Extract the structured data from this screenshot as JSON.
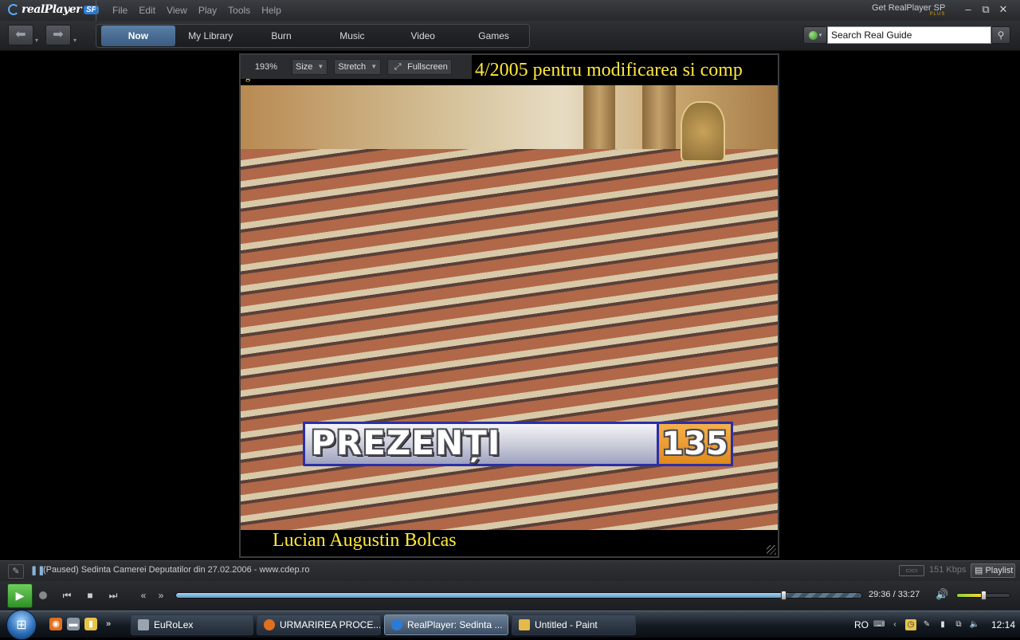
{
  "app": {
    "logo_text": "realPlayer",
    "logo_badge": "SP",
    "menu": [
      "File",
      "Edit",
      "View",
      "Play",
      "Tools",
      "Help"
    ],
    "get_sp": "Get RealPlayer SP",
    "get_sp_plus": "PLUS"
  },
  "toolbar": {
    "tabs": [
      "Now Playing",
      "My Library",
      "Burn",
      "Music",
      "Video",
      "Games"
    ],
    "active_tab": "Now Playing",
    "search_placeholder": "Search Real Guide"
  },
  "video_toolbar": {
    "zoom": "193%",
    "size_label": "Size",
    "stretch_label": "Stretch",
    "fullscreen_label": "Fullscreen"
  },
  "video": {
    "top_caption": "4/2005 pentru modificarea si comp",
    "top_caption_fragment": "g",
    "overlay_label": "PREZENȚI",
    "overlay_count": "135",
    "bottom_caption": "Lucian Augustin Bolcas"
  },
  "status": {
    "text": "(Paused) Sedinta Camerei Deputatilor din 27.02.2006 - www.cdep.ro",
    "bitrate": "151 Kbps",
    "playlist_label": "Playlist"
  },
  "transport": {
    "time": "29:36 / 33:27",
    "progress": 0.885,
    "volume": 0.5
  },
  "taskbar": {
    "tasks": [
      {
        "label": "EuRoLex",
        "active": false
      },
      {
        "label": "URMARIREA PROCE...",
        "active": false
      },
      {
        "label": "RealPlayer: Sedinta ...",
        "active": true
      },
      {
        "label": "Untitled - Paint",
        "active": false
      }
    ],
    "language": "RO",
    "clock": "12:14"
  },
  "colors": {
    "caption_yellow": "#ffe93a",
    "active_tab": "#4a6d95",
    "play_green": "#3fa535"
  }
}
